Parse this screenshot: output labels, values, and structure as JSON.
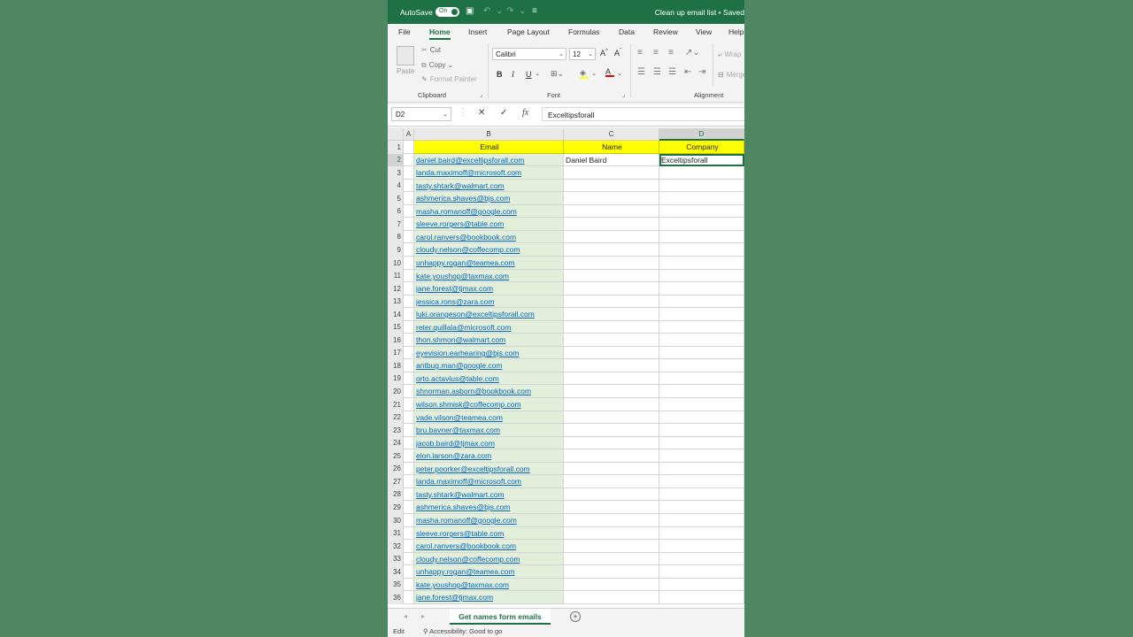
{
  "titlebar": {
    "autosave_label": "AutoSave",
    "autosave_state": "On",
    "doc_title": "Clean up email list • Saved"
  },
  "tabs": [
    "File",
    "Home",
    "Insert",
    "Page Layout",
    "Formulas",
    "Data",
    "Review",
    "View",
    "Help"
  ],
  "active_tab": "Home",
  "ribbon": {
    "clipboard": {
      "paste": "Paste",
      "cut": "Cut",
      "copy": "Copy",
      "format_painter": "Format Painter",
      "label": "Clipboard"
    },
    "font": {
      "name": "Calibri",
      "size": "12",
      "bold": "B",
      "italic": "I",
      "underline": "U",
      "label": "Font"
    },
    "alignment": {
      "wrap": "Wrap",
      "merge": "Merge",
      "label": "Alignment"
    }
  },
  "formula_bar": {
    "name_box": "D2",
    "fx": "fx",
    "content": "Exceltipsforall"
  },
  "columns": [
    "A",
    "B",
    "C",
    "D"
  ],
  "selected_column": "D",
  "headers": {
    "email": "Email",
    "name": "Name",
    "company": "Company"
  },
  "row2": {
    "name": "Daniel Baird",
    "company": "Exceltipsforall"
  },
  "emails": [
    "daniel.baird@exceltipsforall.com",
    "landa.maximoff@microsoft.com",
    "tasty.shtark@walmart.com",
    "ashmerica.shaves@bjs.com",
    "masha.romanoff@google.com",
    "sleeve.rorgers@table.com",
    "carol.ranvers@bookbook.com",
    "cloudy.nelson@coffecomp.com",
    "unhappy.rogan@teamea.com",
    "kate.youshop@taxmax.com",
    "jane.forest@tjmax.com",
    "jessica.rons@zara.com",
    "luki.orangeson@exceltipsforall.com",
    "reter.quillala@microsoft.com",
    "thon.shmon@walmart.com",
    "eyevision.earhearing@bjs.com",
    "antbug.man@google.com",
    "orto.actavius@table.com",
    "shnorman.asborn@bookbook.com",
    "wilson.shmisk@coffecomp.com",
    "vade.vilson@teamea.com",
    "bru.bavner@taxmax.com",
    "jacob.baird@tjmax.com",
    "elon.larson@zara.com",
    "peter.poorker@exceltipsforall.com",
    "landa.maximoff@microsoft.com",
    "tasty.shtark@walmart.com",
    "ashmerica.shaves@bjs.com",
    "masha.romanoff@google.com",
    "sleeve.rorgers@table.com",
    "carol.ranvers@bookbook.com",
    "cloudy.nelson@coffecomp.com",
    "unhappy.rogan@teamea.com",
    "kate.youshop@taxmax.com",
    "jane.forest@tjmax.com"
  ],
  "sheet_tab": "Get names form emails",
  "status": {
    "mode": "Edit",
    "accessibility": "Accessibility: Good to go"
  }
}
